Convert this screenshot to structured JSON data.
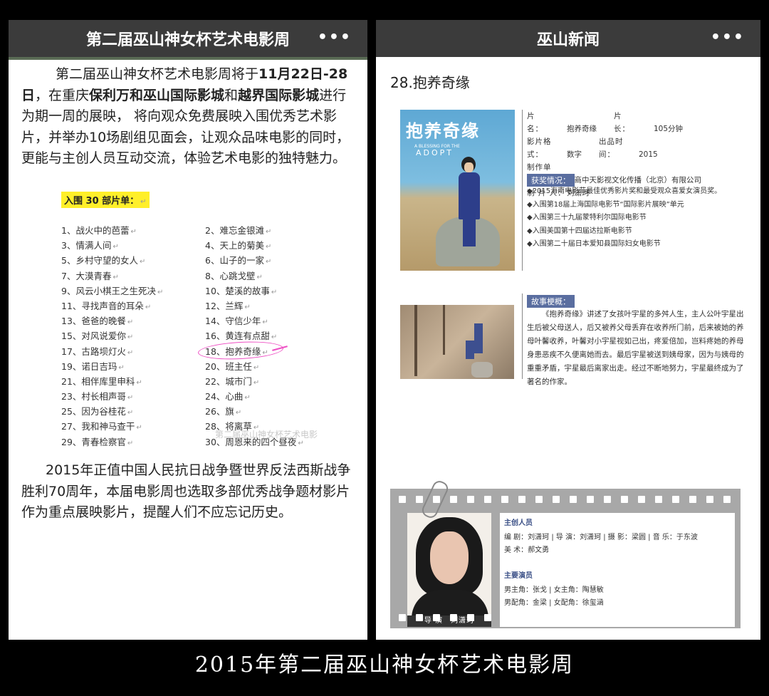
{
  "left": {
    "title": "第二届巫山神女杯艺术电影周",
    "more": "•••",
    "intro": [
      {
        "t": "第二届巫山神女杯艺术电影周将于",
        "b": false
      },
      {
        "t": "11月22日-28日",
        "b": true
      },
      {
        "t": "，在重庆",
        "b": false
      },
      {
        "t": "保利万和巫山国际影城",
        "b": true
      },
      {
        "t": "和",
        "b": false
      },
      {
        "t": "越界国际影城",
        "b": true
      },
      {
        "t": "进行为期一周的展映， 将向观众免费展映入围优秀艺术影片，并举办10场剧组见面会，让观众品味电影的同时，更能与主创人员互动交流，体验艺术电影的独特魅力。",
        "b": false
      }
    ],
    "list_title": "入围 30 部片单：",
    "films": [
      [
        "1、战火中的芭蕾",
        "2、难忘金银滩"
      ],
      [
        "3、情满人间",
        "4、天上的菊美"
      ],
      [
        "5、乡村守望的女人",
        "6、山子的一家"
      ],
      [
        "7、大漠青春",
        "8、心跳戈壁"
      ],
      [
        "9、风云小棋王之生死决",
        "10、楚溪的故事"
      ],
      [
        "11、寻找声音的耳朵",
        "12、兰辉"
      ],
      [
        "13、爸爸的晚餐",
        "14、守信少年"
      ],
      [
        "15、对风说爱你",
        "16、黄连有点甜"
      ],
      [
        "17、古路坝灯火",
        "18、抱养奇缘"
      ],
      [
        "19、诺日吉玛",
        "20、班主任"
      ],
      [
        "21、相伴库里申科",
        "22、城市门"
      ],
      [
        "23、村长相声哥",
        "24、心曲"
      ],
      [
        "25、因为谷桂花",
        "26、旗"
      ],
      [
        "27、我和神马查干",
        "28、将离草"
      ],
      [
        "29、青春检察官",
        "30、周恩来的四个昼夜"
      ]
    ],
    "watermark": "第二届巫山神女杯艺术电影",
    "outro": "2015年正值中国人民抗日战争暨世界反法西斯战争胜利70周年，本届电影周也选取多部优秀战争题材影片作为重点展映影片，提醒人们不应忘记历史。"
  },
  "right": {
    "title": "巫山新闻",
    "more": "•••",
    "heading": "28.抱养奇缘",
    "poster_title": "抱养奇缘",
    "poster_en": "ADOPT",
    "poster_sub": "A BLESSING FOR THE",
    "info": [
      {
        "label": "片　　名：",
        "value": "抱养奇缘",
        "label2": "片　　长：",
        "value2": "105分钟"
      },
      {
        "label": "影片格式：",
        "value": "数字",
        "label2": "出品时间：",
        "value2": "2015"
      },
      {
        "label": "制作单位：",
        "value": "晋商中天影视文化传播（北京）有限公司"
      },
      {
        "label": "制 片 人：",
        "value": "刘潇珂"
      }
    ],
    "awards_label": "获奖情况：",
    "awards": [
      "◆2015海南电影节最佳优秀影片奖和最受观众喜爱女演员奖。",
      "◆入围第18届上海国际电影节“国际影片展映”单元",
      "◆入围第三十九届蒙特利尔国际电影节",
      "◆入围美国第十四届达拉斯电影节",
      "◆入围第二十届日本爱知县国际妇女电影节"
    ],
    "synopsis_label": "故事梗概：",
    "synopsis": "《抱养奇缘》讲述了女孩叶宇星的多舛人生，主人公叶宇星出生后被父母送人，后又被养父母丢弃在收养所门前，后来被她的养母叶馨收养，叶馨对小宇星视如己出，疼爱倍加，岂料疼她的养母身患恶疾不久便离她而去。最后宇星被送到姨母家，因为与姨母的重重矛盾，宇星最后离家出走。经过不断地努力，宇星最终成为了著名的作家。",
    "director_caption": "导 演　刘潇珂",
    "crew_label": "主创人员",
    "crew_line1": "编 剧：刘潇珂 | 导 演：刘潇珂 | 摄 影：梁圆 | 音 乐：于东波",
    "crew_line2": "美 术：郝文勇",
    "cast_label": "主要演员",
    "cast_line1": "男主角：张戈 | 女主角：陶慧敏",
    "cast_line2": "男配角：金梁 | 女配角：徐玺涵"
  },
  "caption": "2015年第二届巫山神女杯艺术电影周"
}
